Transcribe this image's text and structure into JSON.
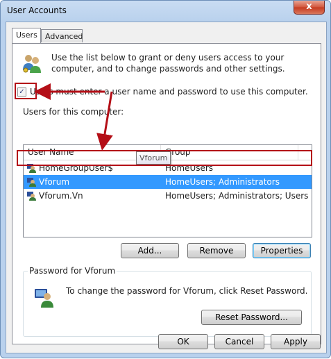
{
  "window": {
    "title": "User Accounts",
    "close_glyph": "x"
  },
  "tabs": [
    {
      "label": "Users",
      "active": true
    },
    {
      "label": "Advanced",
      "active": false
    }
  ],
  "users_tab": {
    "intro_text": "Use the list below to grant or deny users access to your computer, and to change passwords and other settings.",
    "require_login_label": "Users must enter a user name and password to use this computer.",
    "require_login_checked": true,
    "list_label": "Users for this computer:",
    "columns": [
      "User Name",
      "Group"
    ],
    "rows": [
      {
        "user": "HomeGroupUser$",
        "group": "HomeUsers",
        "selected": false
      },
      {
        "user": "Vforum",
        "group": "HomeUsers; Administrators",
        "selected": true
      },
      {
        "user": "Vforum.Vn",
        "group": "HomeUsers; Administrators; Users",
        "selected": false
      }
    ],
    "tooltip": "Vforum",
    "buttons": {
      "add": "Add...",
      "remove": "Remove",
      "properties": "Properties"
    },
    "password_group": {
      "legend": "Password for Vforum",
      "text": "To change the password for Vforum, click Reset Password.",
      "reset_button": "Reset Password..."
    }
  },
  "footer": {
    "ok": "OK",
    "cancel": "Cancel",
    "apply": "Apply"
  },
  "annotation_color": "#b40f17",
  "selection_color": "#3399ff",
  "icons": [
    "users-icon",
    "user-icon",
    "password-user-icon",
    "close-icon",
    "arrow-annotation"
  ]
}
